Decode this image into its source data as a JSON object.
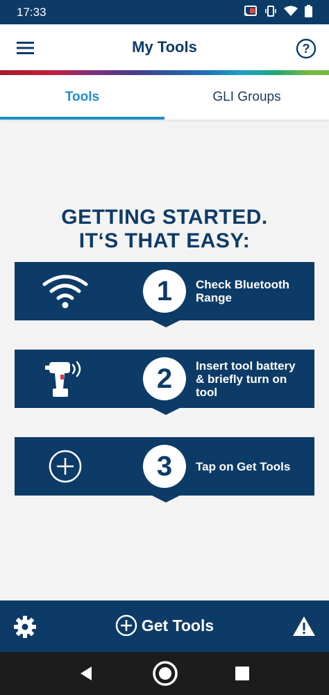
{
  "statusbar": {
    "time": "17:33"
  },
  "appbar": {
    "title": "My Tools"
  },
  "tabs": [
    {
      "label": "Tools"
    },
    {
      "label": "GLI Groups"
    }
  ],
  "heading": {
    "line1": "GETTING STARTED.",
    "line2": "IT‘S THAT EASY:"
  },
  "steps": [
    {
      "number": "1",
      "text": "Check Bluetooth Range"
    },
    {
      "number": "2",
      "text": "Insert tool battery & briefly turn on tool"
    },
    {
      "number": "3",
      "text": "Tap on Get Tools"
    }
  ],
  "bottombar": {
    "get_tools_label": "Get Tools"
  },
  "colors": {
    "brand_navy": "#0d3b67",
    "accent_blue": "#1d8fc7"
  }
}
